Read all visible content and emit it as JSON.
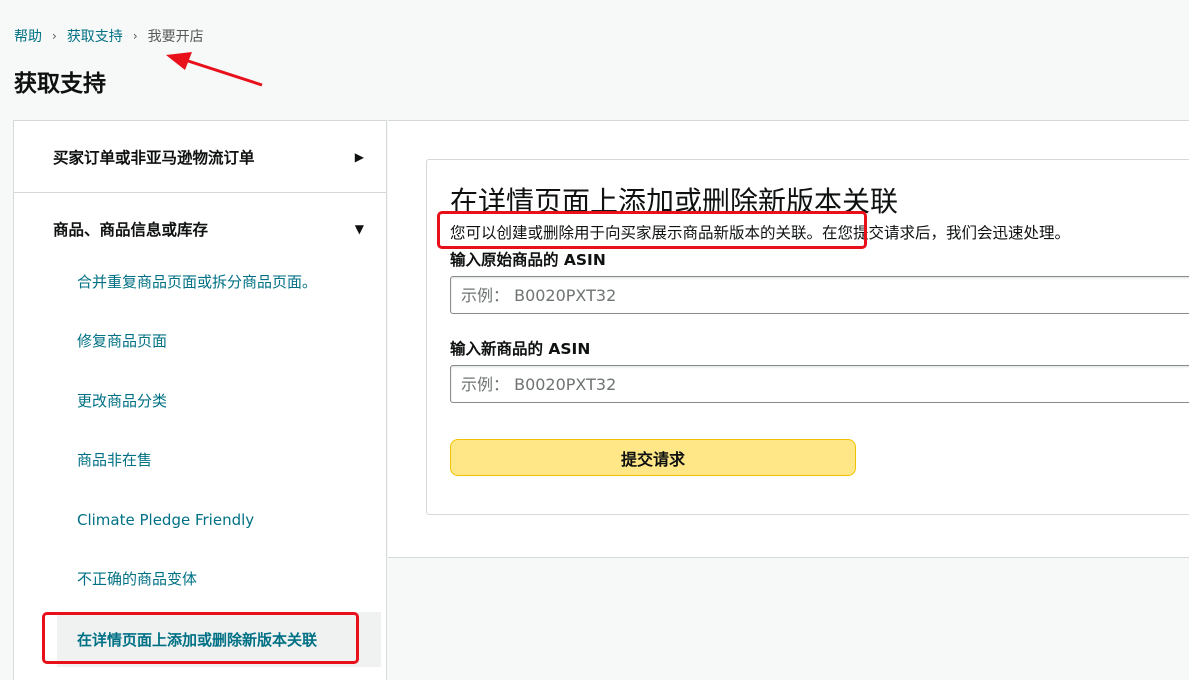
{
  "breadcrumb": {
    "items": [
      "帮助",
      "获取支持"
    ],
    "current": "我要开店",
    "separator": "›"
  },
  "page_title": "获取支持",
  "sidebar": {
    "categories": [
      {
        "label": "买家订单或非亚马逊物流订单",
        "expanded": false,
        "arrow": "▶"
      },
      {
        "label": "商品、商品信息或库存",
        "expanded": true,
        "arrow": "▼"
      }
    ],
    "items": [
      "合并重复商品页面或拆分商品页面。",
      "修复商品页面",
      "更改商品分类",
      "商品非在售",
      "Climate Pledge Friendly",
      "不正确的商品变体"
    ],
    "active_item": "在详情页面上添加或删除新版本关联"
  },
  "form": {
    "title": "在详情页面上添加或删除新版本关联",
    "description_part1": "您可以创建或删除用于向买家展示商品新版本的关联。",
    "description_part2": "在您提交请求后，我们会迅速处理。",
    "original_asin_label": "输入原始商品的 ASIN",
    "original_asin_placeholder": "示例： B0020PXT32",
    "new_asin_label": "输入新商品的 ASIN",
    "new_asin_placeholder": "示例： B0020PXT32",
    "submit_label": "提交请求"
  },
  "colors": {
    "link": "#007185",
    "button_bg": "#ffe788",
    "button_border": "#f2c200",
    "annotation": "#e8111b",
    "page_bg": "#f7f8f8"
  }
}
